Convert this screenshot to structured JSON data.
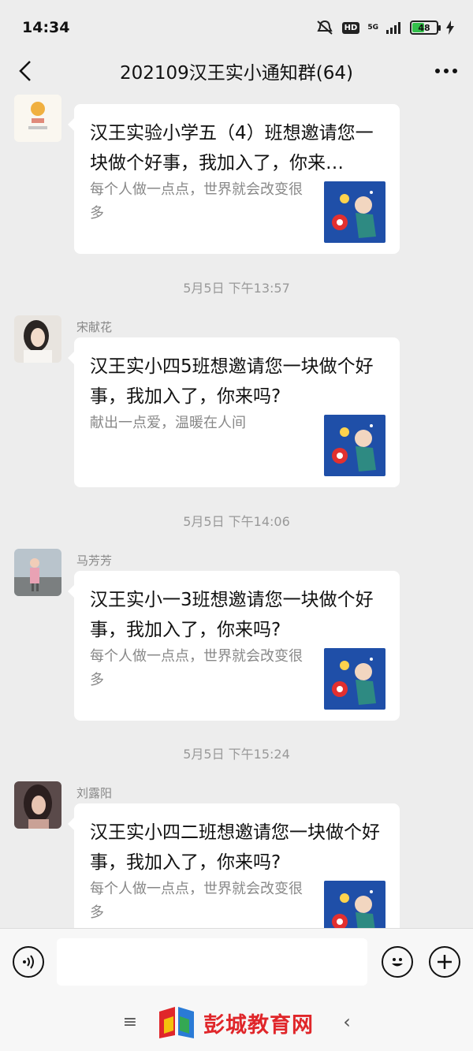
{
  "status_bar": {
    "time": "14:34",
    "network": "5G",
    "hd": "HD",
    "battery": "48",
    "battery_level": 0.48
  },
  "header": {
    "title": "202109汉王实小通知群(64)"
  },
  "messages": [
    {
      "sender": "",
      "title": "汉王实验小学五（4）班想邀请您一块做个好事，我加入了，你来…",
      "desc": "每个人做一点点，世界就会改变很多"
    },
    {
      "time": "5月5日 下午13:57",
      "sender": "宋献花",
      "title": "汉王实小四5班想邀请您一块做个好事，我加入了，你来吗?",
      "desc": "献出一点爱，温暖在人间"
    },
    {
      "time": "5月5日 下午14:06",
      "sender": "马芳芳",
      "title": "汉王实小一3班想邀请您一块做个好事，我加入了，你来吗?",
      "desc": "每个人做一点点，世界就会改变很多"
    },
    {
      "time": "5月5日 下午15:24",
      "sender": "刘露阳",
      "title": "汉王实小四二班想邀请您一块做个好事，我加入了，你来吗?",
      "desc": "每个人做一点点，世界就会改变很多"
    }
  ],
  "watermark": {
    "text": "彭城教育网"
  },
  "colors": {
    "background": "#ededed",
    "card": "#ffffff",
    "watermark": "#e0262a",
    "battery": "#33c04b"
  }
}
